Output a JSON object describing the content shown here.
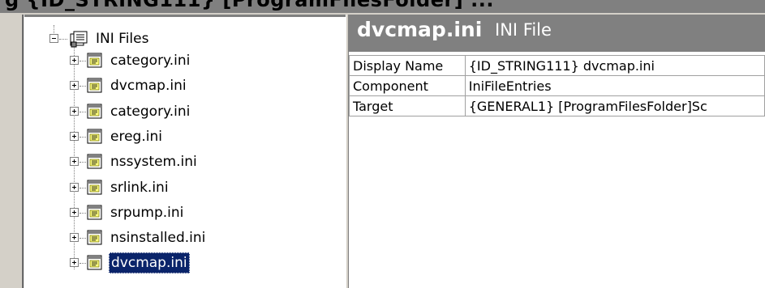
{
  "window": {
    "clipped_heading": "g    {ID_STRING111}    [ProgramFilesFolder]    ..."
  },
  "tree": {
    "root": {
      "label": "INI Files",
      "icon": "ini-files-folder-icon",
      "expanded": true
    },
    "items": [
      {
        "label": "category.ini",
        "icon": "ini-file-icon",
        "selected": false
      },
      {
        "label": "dvcmap.ini",
        "icon": "ini-file-icon",
        "selected": false
      },
      {
        "label": "category.ini",
        "icon": "ini-file-icon",
        "selected": false
      },
      {
        "label": "ereg.ini",
        "icon": "ini-file-icon",
        "selected": false
      },
      {
        "label": "nssystem.ini",
        "icon": "ini-file-icon",
        "selected": false
      },
      {
        "label": "srlink.ini",
        "icon": "ini-file-icon",
        "selected": false
      },
      {
        "label": "srpump.ini",
        "icon": "ini-file-icon",
        "selected": false
      },
      {
        "label": "nsinstalled.ini",
        "icon": "ini-file-icon",
        "selected": false
      },
      {
        "label": "dvcmap.ini",
        "icon": "ini-file-icon",
        "selected": true
      }
    ]
  },
  "detail": {
    "title": "dvcmap.ini",
    "subtitle": "INI File",
    "properties": [
      {
        "name": "Display Name",
        "value": "{ID_STRING111} dvcmap.ini"
      },
      {
        "name": "Component",
        "value": "IniFileEntries"
      },
      {
        "name": "Target",
        "value": "{GENERAL1} [ProgramFilesFolder]Sc"
      }
    ]
  },
  "colors": {
    "header_bg": "#808080",
    "chrome": "#d4d0c8",
    "selection_bg": "#0a246a",
    "selection_fg": "#ffffff"
  }
}
